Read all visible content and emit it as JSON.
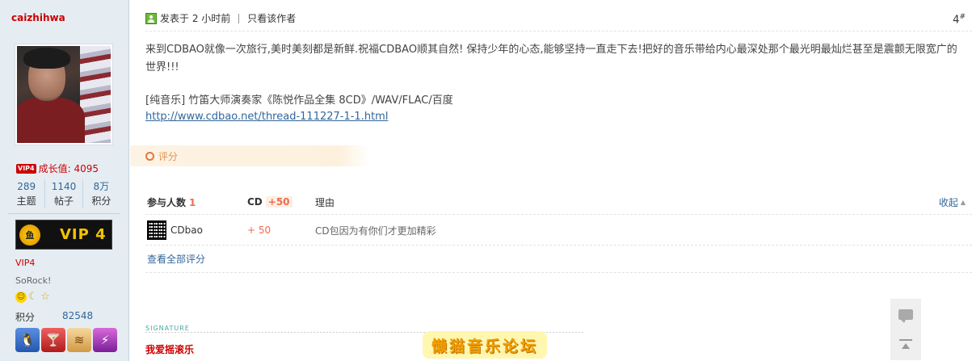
{
  "user": {
    "name": "caizhihwa",
    "vip_badge": "VIP4",
    "growth_label": "成长值: 4095",
    "stats": [
      {
        "value": "289",
        "label": "主题"
      },
      {
        "value": "1140",
        "label": "帖子"
      },
      {
        "value": "8万",
        "label": "积分"
      }
    ],
    "vip_banner_text": "VIP 4",
    "vip_emblem": "鱼",
    "vip_level": "VIP4",
    "title": "SoRock!",
    "points_label": "积分",
    "points_value": "82548",
    "medal_icons": [
      "penguin-icon",
      "cocktail-icon",
      "flag-icon",
      "lightning-icon"
    ],
    "medal_glyphs": [
      "🐧",
      "🍸",
      "≋",
      "⚡"
    ],
    "level_icons": [
      "smile-icon",
      "moon-icon",
      "star-icon"
    ],
    "level_glyphs": [
      "☺",
      "☾",
      "☆"
    ]
  },
  "post": {
    "posted_label": "发表于 2 小时前",
    "author_only": "只看该作者",
    "floor_number": "4",
    "floor_suffix": "#",
    "message": "来到CDBAO就像一次旅行,美时美刻都是新鲜.祝福CDBAO顺其自然! 保持少年的心态,能够坚持一直走下去!把好的音乐带给内心最深处那个最光明最灿烂甚至是震颤无限宽广的世界!!!",
    "resource_title": "[纯音乐] 竹笛大师演奏家《陈悦作品全集 8CD》/WAV/FLAC/百度",
    "resource_link": "http://www.cdbao.net/thread-111227-1-1.html"
  },
  "rating": {
    "section_label": "评分",
    "participants_label": "参与人数",
    "participants_count": "1",
    "currency_label": "CD",
    "total": "+50",
    "reason_label": "理由",
    "collapse_label": "收起",
    "collapse_icon": "caret-up-icon",
    "rows": [
      {
        "user": "CDbao",
        "score": "+ 50",
        "reason": "CD包因为有你们才更加精彩"
      }
    ],
    "view_all": "查看全部评分"
  },
  "signature": {
    "label": "SIGNATURE",
    "text": "我爱摇滚乐",
    "banner": "懒猫音乐论坛"
  },
  "colors": {
    "sidebar_bg": "#e5edf2",
    "link": "#336699",
    "accent_red": "#cc0000",
    "rate_orange": "#f26c4f"
  }
}
